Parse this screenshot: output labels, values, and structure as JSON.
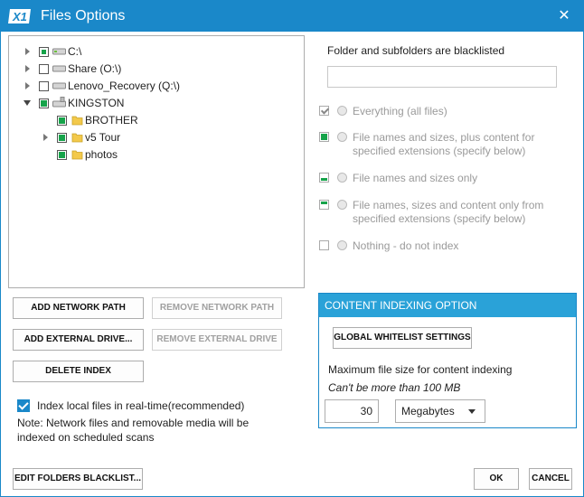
{
  "window": {
    "title": "Files Options",
    "logo_text": "X1",
    "accent": "#1a88c9"
  },
  "tree": {
    "nodes": [
      {
        "label": "C:\\"
      },
      {
        "label": "Share (O:\\)"
      },
      {
        "label": "Lenovo_Recovery (Q:\\)"
      },
      {
        "label": "KINGSTON"
      },
      {
        "label": "BROTHER"
      },
      {
        "label": "v5 Tour"
      },
      {
        "label": "photos"
      }
    ]
  },
  "buttons": {
    "add_network": "ADD NETWORK PATH",
    "remove_network": "REMOVE NETWORK PATH",
    "add_external": "ADD EXTERNAL DRIVE...",
    "remove_external": "REMOVE EXTERNAL DRIVE",
    "delete_index": "DELETE INDEX",
    "edit_blacklist": "EDIT FOLDERS BLACKLIST...",
    "ok": "OK",
    "cancel": "CANCEL"
  },
  "realtime": {
    "label": "Index local files in real-time(recommended)",
    "note_line1": "Note: Network files and removable media will be",
    "note_line2": "indexed on scheduled scans"
  },
  "blacklist": {
    "heading": "Folder and subfolders are blacklisted",
    "value": ""
  },
  "options": [
    {
      "line1": "Everything (all files)"
    },
    {
      "line1": "File names and sizes, plus content for",
      "line2": "specified extensions (specify below)"
    },
    {
      "line1": "File names and sizes only"
    },
    {
      "line1": "File names, sizes and content only from",
      "line2": "specified extensions (specify below)"
    },
    {
      "line1": "Nothing - do not index"
    }
  ],
  "content": {
    "header": "CONTENT INDEXING OPTION",
    "whitelist_button": "GLOBAL WHITELIST SETTINGS",
    "max_label": "Maximum file size for content indexing",
    "limit_note": "Can't be more than 100 MB",
    "size_value": "30",
    "unit": "Megabytes"
  }
}
